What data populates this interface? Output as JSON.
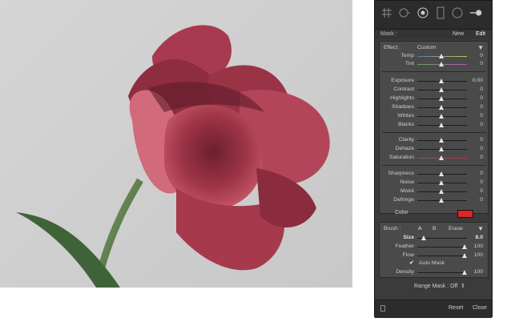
{
  "mask_header": {
    "label": "Mask :",
    "new": "New",
    "edit": "Edit"
  },
  "effect": {
    "label": "Effect :",
    "value": "Custom"
  },
  "sliders": {
    "temp": {
      "label": "Temp",
      "value": "0"
    },
    "tint": {
      "label": "Tint",
      "value": "0"
    },
    "exposure": {
      "label": "Exposure",
      "value": "0.00"
    },
    "contrast": {
      "label": "Contrast",
      "value": "0"
    },
    "highlights": {
      "label": "Highlights",
      "value": "0"
    },
    "shadows": {
      "label": "Shadows",
      "value": "0"
    },
    "whites": {
      "label": "Whites",
      "value": "0"
    },
    "blacks": {
      "label": "Blacks",
      "value": "0"
    },
    "clarity": {
      "label": "Clarity",
      "value": "0"
    },
    "dehaze": {
      "label": "Dehaze",
      "value": "0"
    },
    "saturation": {
      "label": "Saturation",
      "value": "0"
    },
    "sharpness": {
      "label": "Sharpness",
      "value": "0"
    },
    "noise": {
      "label": "Noise",
      "value": "0"
    },
    "moire": {
      "label": "Moiré",
      "value": "0"
    },
    "defringe": {
      "label": "Defringe",
      "value": "0"
    }
  },
  "color": {
    "label": "Color",
    "swatch": "#d9262b"
  },
  "brush": {
    "label": "Brush :",
    "a": "A",
    "b": "B",
    "erase": "Erase",
    "size": {
      "label": "Size",
      "value": "8.0"
    },
    "feather": {
      "label": "Feather",
      "value": "100"
    },
    "flow": {
      "label": "Flow",
      "value": "100"
    },
    "auto_mask": "Auto Mask",
    "density": {
      "label": "Density",
      "value": "100"
    }
  },
  "range_mask": {
    "label": "Range Mask : Off"
  },
  "footer": {
    "reset": "Reset",
    "close": "Close"
  }
}
